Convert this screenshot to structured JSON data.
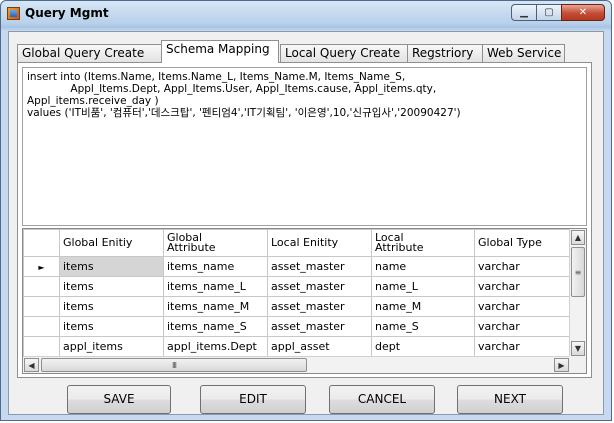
{
  "window": {
    "title": "Query Mgmt"
  },
  "tabs": [
    {
      "label": "Global Query Create"
    },
    {
      "label": "Schema Mapping"
    },
    {
      "label": "Local Query Create"
    },
    {
      "label": "Regstriory"
    },
    {
      "label": "Web Service"
    }
  ],
  "active_tab": "Schema Mapping",
  "sql_text": "insert into (Items.Name, Items.Name_L, Items_Name.M, Items_Name_S,\n             Appl_Items.Dept, Appl_Items.User, Appl_Items.cause, Appl_items.qty,\nAppl_items.receive_day )\nvalues ('IT비품', '컴퓨터','데스크탑', '펜티엄4','IT기획팀', '이은영',10,'신규입사','20090427')",
  "grid": {
    "columns": [
      "Global Enitiy",
      "Global\nAttribute",
      "Local Enitity",
      "Local\nAttribute",
      "Global Type"
    ],
    "rows": [
      [
        "items",
        "items_name",
        "asset_master",
        "name",
        "varchar"
      ],
      [
        "items",
        "items_name_L",
        "asset_master",
        "name_L",
        "varchar"
      ],
      [
        "items",
        "items_name_M",
        "asset_master",
        "name_M",
        "varchar"
      ],
      [
        "items",
        "items_name_S",
        "asset_master",
        "name_S",
        "varchar"
      ],
      [
        "appl_items",
        "appl_items.Dept",
        "appl_asset",
        "dept",
        "varchar"
      ]
    ],
    "current_row_marker": "►",
    "hscroll_thumb_grip": "III"
  },
  "buttons": {
    "save": "SAVE",
    "edit": "EDIT",
    "cancel": "CANCEL",
    "next": "NEXT"
  },
  "icons": {
    "minimize": "minimize-icon",
    "maximize": "maximize-icon",
    "close": "close-icon"
  }
}
